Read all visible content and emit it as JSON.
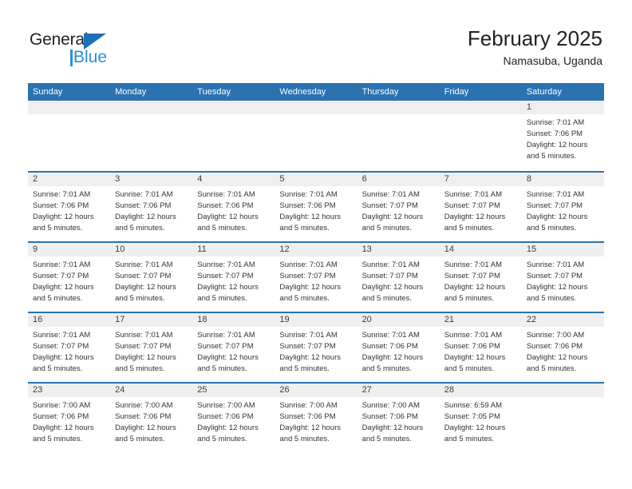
{
  "brand": {
    "name_dark": "General",
    "name_blue": "Blue",
    "accent_color": "#2b8fd8",
    "triangle_color": "#1d6fb8"
  },
  "header": {
    "title": "February 2025",
    "subtitle": "Namasuba, Uganda"
  },
  "theme": {
    "header_band": "#2b72b1",
    "day_band": "#efefef",
    "text": "#333333"
  },
  "weekdays": [
    "Sunday",
    "Monday",
    "Tuesday",
    "Wednesday",
    "Thursday",
    "Friday",
    "Saturday"
  ],
  "weeks": [
    [
      {
        "day": "",
        "lines": []
      },
      {
        "day": "",
        "lines": []
      },
      {
        "day": "",
        "lines": []
      },
      {
        "day": "",
        "lines": []
      },
      {
        "day": "",
        "lines": []
      },
      {
        "day": "",
        "lines": []
      },
      {
        "day": "1",
        "lines": [
          "Sunrise: 7:01 AM",
          "Sunset: 7:06 PM",
          "Daylight: 12 hours",
          "and 5 minutes."
        ]
      }
    ],
    [
      {
        "day": "2",
        "lines": [
          "Sunrise: 7:01 AM",
          "Sunset: 7:06 PM",
          "Daylight: 12 hours",
          "and 5 minutes."
        ]
      },
      {
        "day": "3",
        "lines": [
          "Sunrise: 7:01 AM",
          "Sunset: 7:06 PM",
          "Daylight: 12 hours",
          "and 5 minutes."
        ]
      },
      {
        "day": "4",
        "lines": [
          "Sunrise: 7:01 AM",
          "Sunset: 7:06 PM",
          "Daylight: 12 hours",
          "and 5 minutes."
        ]
      },
      {
        "day": "5",
        "lines": [
          "Sunrise: 7:01 AM",
          "Sunset: 7:06 PM",
          "Daylight: 12 hours",
          "and 5 minutes."
        ]
      },
      {
        "day": "6",
        "lines": [
          "Sunrise: 7:01 AM",
          "Sunset: 7:07 PM",
          "Daylight: 12 hours",
          "and 5 minutes."
        ]
      },
      {
        "day": "7",
        "lines": [
          "Sunrise: 7:01 AM",
          "Sunset: 7:07 PM",
          "Daylight: 12 hours",
          "and 5 minutes."
        ]
      },
      {
        "day": "8",
        "lines": [
          "Sunrise: 7:01 AM",
          "Sunset: 7:07 PM",
          "Daylight: 12 hours",
          "and 5 minutes."
        ]
      }
    ],
    [
      {
        "day": "9",
        "lines": [
          "Sunrise: 7:01 AM",
          "Sunset: 7:07 PM",
          "Daylight: 12 hours",
          "and 5 minutes."
        ]
      },
      {
        "day": "10",
        "lines": [
          "Sunrise: 7:01 AM",
          "Sunset: 7:07 PM",
          "Daylight: 12 hours",
          "and 5 minutes."
        ]
      },
      {
        "day": "11",
        "lines": [
          "Sunrise: 7:01 AM",
          "Sunset: 7:07 PM",
          "Daylight: 12 hours",
          "and 5 minutes."
        ]
      },
      {
        "day": "12",
        "lines": [
          "Sunrise: 7:01 AM",
          "Sunset: 7:07 PM",
          "Daylight: 12 hours",
          "and 5 minutes."
        ]
      },
      {
        "day": "13",
        "lines": [
          "Sunrise: 7:01 AM",
          "Sunset: 7:07 PM",
          "Daylight: 12 hours",
          "and 5 minutes."
        ]
      },
      {
        "day": "14",
        "lines": [
          "Sunrise: 7:01 AM",
          "Sunset: 7:07 PM",
          "Daylight: 12 hours",
          "and 5 minutes."
        ]
      },
      {
        "day": "15",
        "lines": [
          "Sunrise: 7:01 AM",
          "Sunset: 7:07 PM",
          "Daylight: 12 hours",
          "and 5 minutes."
        ]
      }
    ],
    [
      {
        "day": "16",
        "lines": [
          "Sunrise: 7:01 AM",
          "Sunset: 7:07 PM",
          "Daylight: 12 hours",
          "and 5 minutes."
        ]
      },
      {
        "day": "17",
        "lines": [
          "Sunrise: 7:01 AM",
          "Sunset: 7:07 PM",
          "Daylight: 12 hours",
          "and 5 minutes."
        ]
      },
      {
        "day": "18",
        "lines": [
          "Sunrise: 7:01 AM",
          "Sunset: 7:07 PM",
          "Daylight: 12 hours",
          "and 5 minutes."
        ]
      },
      {
        "day": "19",
        "lines": [
          "Sunrise: 7:01 AM",
          "Sunset: 7:07 PM",
          "Daylight: 12 hours",
          "and 5 minutes."
        ]
      },
      {
        "day": "20",
        "lines": [
          "Sunrise: 7:01 AM",
          "Sunset: 7:06 PM",
          "Daylight: 12 hours",
          "and 5 minutes."
        ]
      },
      {
        "day": "21",
        "lines": [
          "Sunrise: 7:01 AM",
          "Sunset: 7:06 PM",
          "Daylight: 12 hours",
          "and 5 minutes."
        ]
      },
      {
        "day": "22",
        "lines": [
          "Sunrise: 7:00 AM",
          "Sunset: 7:06 PM",
          "Daylight: 12 hours",
          "and 5 minutes."
        ]
      }
    ],
    [
      {
        "day": "23",
        "lines": [
          "Sunrise: 7:00 AM",
          "Sunset: 7:06 PM",
          "Daylight: 12 hours",
          "and 5 minutes."
        ]
      },
      {
        "day": "24",
        "lines": [
          "Sunrise: 7:00 AM",
          "Sunset: 7:06 PM",
          "Daylight: 12 hours",
          "and 5 minutes."
        ]
      },
      {
        "day": "25",
        "lines": [
          "Sunrise: 7:00 AM",
          "Sunset: 7:06 PM",
          "Daylight: 12 hours",
          "and 5 minutes."
        ]
      },
      {
        "day": "26",
        "lines": [
          "Sunrise: 7:00 AM",
          "Sunset: 7:06 PM",
          "Daylight: 12 hours",
          "and 5 minutes."
        ]
      },
      {
        "day": "27",
        "lines": [
          "Sunrise: 7:00 AM",
          "Sunset: 7:06 PM",
          "Daylight: 12 hours",
          "and 5 minutes."
        ]
      },
      {
        "day": "28",
        "lines": [
          "Sunrise: 6:59 AM",
          "Sunset: 7:05 PM",
          "Daylight: 12 hours",
          "and 5 minutes."
        ]
      },
      {
        "day": "",
        "lines": []
      }
    ]
  ]
}
